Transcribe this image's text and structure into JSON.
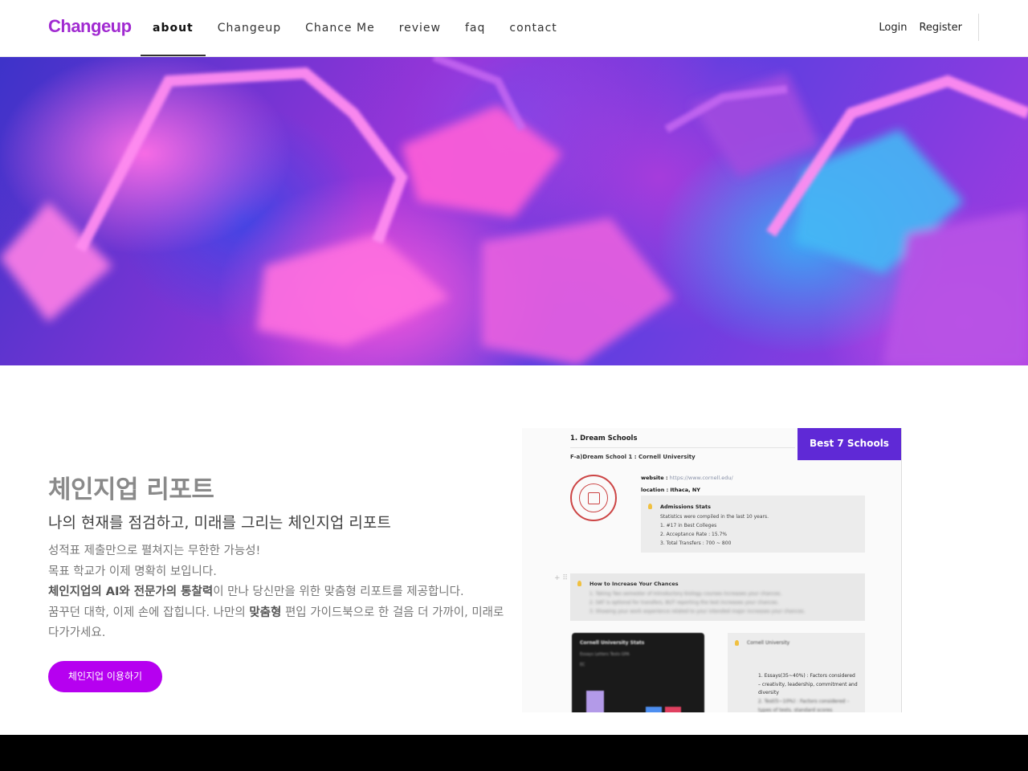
{
  "nav": {
    "logo": "Changeup",
    "items": [
      {
        "label": "about",
        "active": true
      },
      {
        "label": "Changeup",
        "active": false
      },
      {
        "label": "Chance Me",
        "active": false
      },
      {
        "label": "review",
        "active": false
      },
      {
        "label": "faq",
        "active": false
      },
      {
        "label": "contact",
        "active": false
      }
    ],
    "login": "Login",
    "register": "Register"
  },
  "hero": {
    "image": "abstract pink-blue geometric hero banner"
  },
  "section": {
    "title": "체인지업 리포트",
    "subtitle": "나의 현재를 점검하고, 미래를 그리는 체인지업 리포트",
    "desc": {
      "line1": "성적표 제출만으로 펼쳐지는 무한한 가능성!",
      "line2": "목표 학교가 이제 명확히 보입니다.",
      "line3_bold1": "체인지업의 AI와 전문가의 통찰력",
      "line3_rest": "이 만나 당신만을 위한 맞춤형 리포트를 제공합니다.",
      "line4_pre": "꿈꾸던 대학, 이제 손에 잡힙니다. 나만의 ",
      "line4_bold": "맞춤형",
      "line4_rest": " 편입 가이드북으로 한 걸음 더 가까이, 미래로 다가가세요."
    },
    "cta": "체인지업 이용하기"
  },
  "preview": {
    "badge": "Best 7 Schools",
    "heading": "1. Dream Schools",
    "subheading": "F-a)Dream School 1 : Cornell University",
    "website_label": "website :",
    "website_value": "https://www.cornell.edu/",
    "location_label": "location :",
    "location_value": "Ithaca, NY",
    "stats_title": "Admissions Stats",
    "stats_lines": [
      "Statistics were compiled in the last 10 years.",
      "1. #17 in Best Colleges",
      "2. Acceptance Rate : 15.7%",
      "3. Total Transfers : 700 ~ 800"
    ],
    "chances_title": "How to Increase Your Chances",
    "chances_lines": [
      "1. Taking Two semester of Introductory biology courses increases your chances.",
      "2. SAT is optional for transfers, BUT reporting the test increases your chances.",
      "3. Showing your work experience related to your intended major increases your chances."
    ],
    "dark_title": "Cornell University Stats",
    "dark_legend": "Essays  Letters  Tests  GPA",
    "dark_legend2": "EC",
    "right_head": "Cornell University",
    "right_lines": [
      "1.  Essays(35~40%) : Factors considered – creativity, leadership, commitment and diversity",
      "2.  Test(5~10%) : Factors considered – types of tests, standard scores"
    ]
  },
  "colors": {
    "brand": "#a12bd1",
    "cta": "#b600f0",
    "badge": "#5f29d6"
  }
}
